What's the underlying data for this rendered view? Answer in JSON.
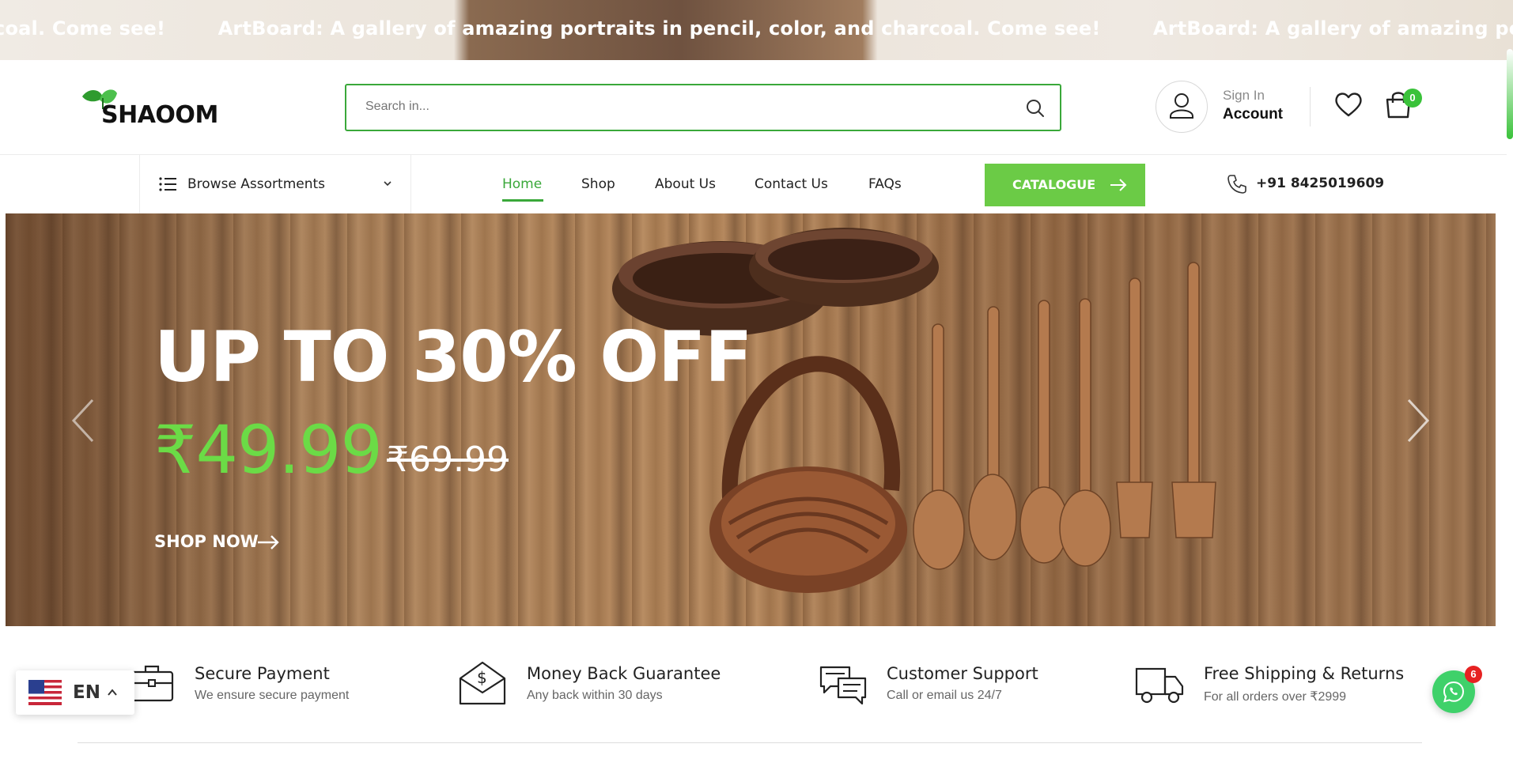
{
  "announcement": {
    "items": [
      "rcoal. Come see!",
      "ArtBoard: A gallery of amazing portraits in pencil, color, and charcoal. Come see!",
      "ArtBoard: A gallery of amazing portraits in pencil,"
    ]
  },
  "header": {
    "logo_text": "SHAOOM",
    "search": {
      "placeholder": "Search in...",
      "icon": "search-icon"
    },
    "account": {
      "sign_in_label": "Sign In",
      "account_label": "Account",
      "icon": "user-icon"
    },
    "wishlist_icon": "heart-icon",
    "cart": {
      "icon": "shopping-bag-icon",
      "count": "0"
    }
  },
  "nav": {
    "browse_label": "Browse Assortments",
    "links": [
      "Home",
      "Shop",
      "About Us",
      "Contact Us",
      "FAQs"
    ],
    "active": "Home",
    "catalogue_label": "CATALOGUE",
    "phone": "+91 8425019609"
  },
  "hero": {
    "title": "UP TO 30% OFF",
    "price": "₹49.99",
    "old_price": "₹69.99",
    "cta": "SHOP NOW"
  },
  "features": [
    {
      "icon": "briefcase-icon",
      "title": "Secure Payment",
      "subtitle": "We ensure secure payment"
    },
    {
      "icon": "money-envelope-icon",
      "title": "Money Back Guarantee",
      "subtitle": "Any back within 30 days"
    },
    {
      "icon": "chat-bubbles-icon",
      "title": "Customer Support",
      "subtitle": "Call or email us 24/7"
    },
    {
      "icon": "truck-icon",
      "title": "Free Shipping & Returns",
      "subtitle": "For all orders over ₹2999"
    }
  ],
  "language": {
    "code": "EN",
    "flag": "us-flag-icon"
  },
  "whatsapp": {
    "badge": "6",
    "icon": "whatsapp-icon"
  },
  "colors": {
    "brand_green": "#3aa83a",
    "catalogue_green": "#6bcb46",
    "price_green": "#6bdb46"
  }
}
